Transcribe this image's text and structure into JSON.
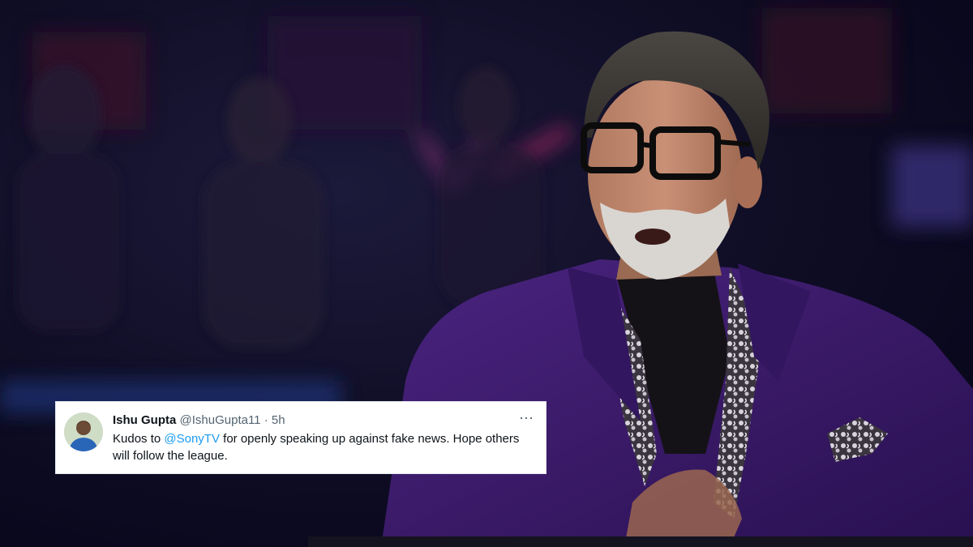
{
  "tweet": {
    "author_name": "Ishu Gupta",
    "author_handle": "@IshuGupta11",
    "separator": "·",
    "time": "5h",
    "more_icon": "⋯",
    "text_before": "Kudos to ",
    "mention": "@SonyTV",
    "text_after": " for openly speaking up against fake news. Hope others will follow the league."
  },
  "colors": {
    "suit": "#3b1a6b",
    "mention": "#1d9bf0",
    "background": "#0b0a1c"
  }
}
